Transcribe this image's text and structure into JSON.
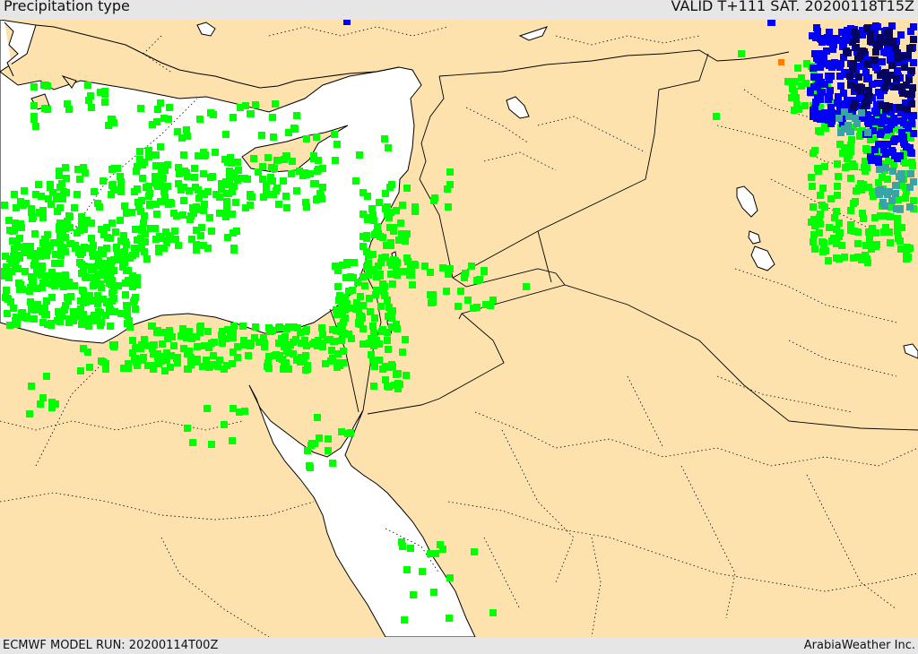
{
  "header": {
    "title": "Precipitation type",
    "valid_time": "VALID T+111 SAT. 20200118T15Z"
  },
  "footer": {
    "model_run": "ECMWF MODEL RUN: 20200114T00Z",
    "credit": "ArabiaWeather Inc."
  },
  "colors": {
    "land": "#fde2ae",
    "sea": "#ffffff",
    "rain": "#00ff00",
    "snow": "#0000f5",
    "heavy_snow": "#06065e",
    "sleet": "#3aa3a3",
    "freezing": "#ff7a00",
    "coast": "#000000",
    "border": "#000000"
  }
}
